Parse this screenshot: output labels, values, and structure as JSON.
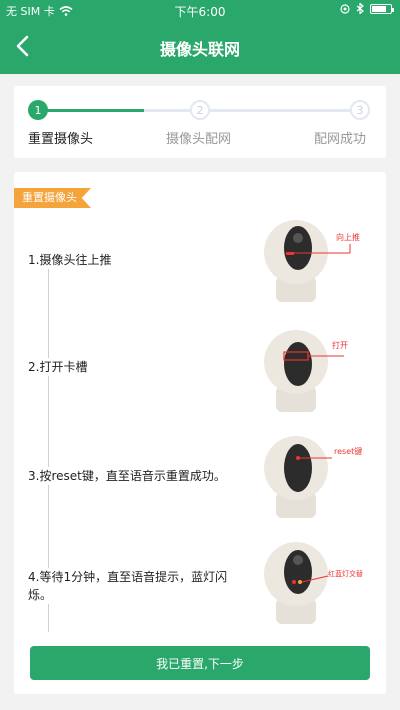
{
  "status_bar": {
    "carrier": "无 SIM 卡",
    "time": "下午6:00"
  },
  "header": {
    "title": "摄像头联网",
    "background_color": "#2aa76a"
  },
  "progress": {
    "steps": [
      {
        "number": "1",
        "label": "重置摄像头",
        "state": "active"
      },
      {
        "number": "2",
        "label": "摄像头配网",
        "state": "inactive"
      },
      {
        "number": "3",
        "label": "配网成功",
        "state": "inactive"
      }
    ]
  },
  "section": {
    "tag": "重置摄像头",
    "tag_color": "#f5a33b"
  },
  "instructions": [
    {
      "text": "1.摄像头往上推",
      "annotation": "向上推"
    },
    {
      "text": "2.打开卡槽",
      "annotation": "打开"
    },
    {
      "text": "3.按reset键，直至语音示重置成功。",
      "annotation": "reset键"
    },
    {
      "text": "4.等待1分钟，直至语音提示，蓝灯闪烁。",
      "annotation": "红蓝灯交替"
    }
  ],
  "footer": {
    "next_button": "我已重置,下一步"
  }
}
